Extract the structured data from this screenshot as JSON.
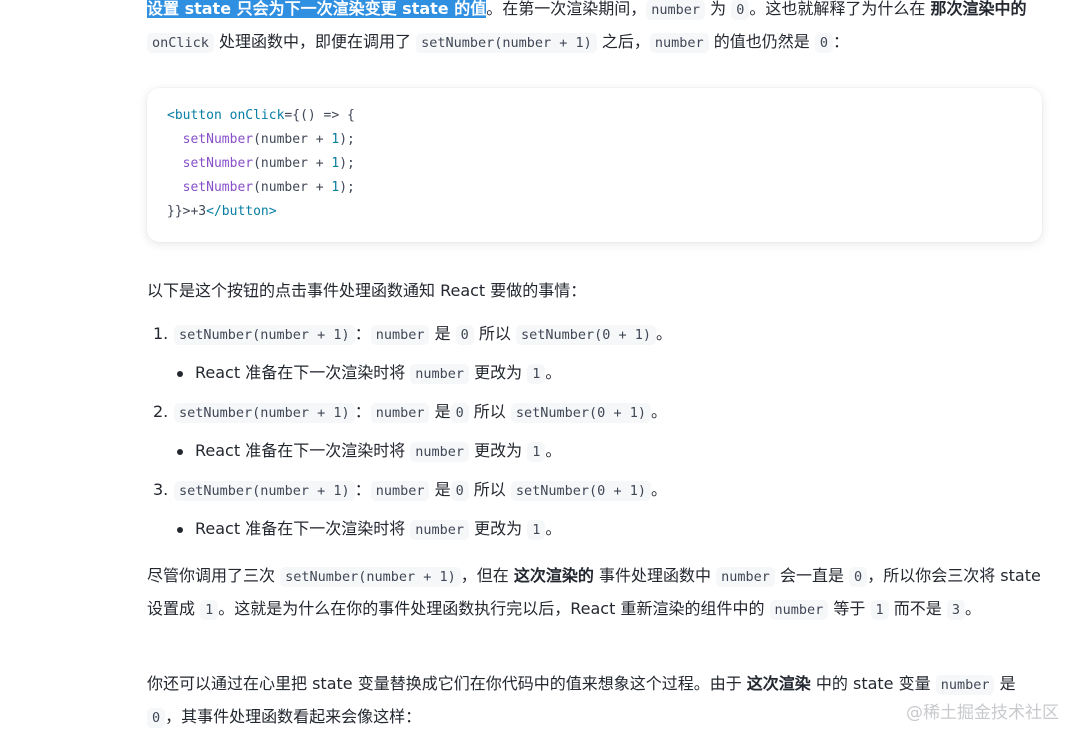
{
  "p1": {
    "highlight": "设置 state 只会为下一次渲染变更 state 的值",
    "t1": "。在第一次渲染期间，",
    "c1": "number",
    "t2": " 为 ",
    "c2": "0",
    "t3": "。这也就解释了为什么在 ",
    "b1": "那次渲染中的",
    "t4": " ",
    "c3": "onClick",
    "t5": " 处理函数中，即便在调用了 ",
    "c4": "setNumber(number + 1)",
    "t6": " 之后，",
    "c5": "number",
    "t7": " 的值也仍然是 ",
    "c6": "0",
    "t8": "："
  },
  "code": {
    "l1_tag_open": "<button",
    "l1_attr": "onClick",
    "l1_rest": "={() => {",
    "fn": "setNumber",
    "call_args": "(number + ",
    "one": "1",
    "call_end": ");",
    "l5_a": "}}>",
    "l5_b": "+3",
    "l5_c": "</button>"
  },
  "p2": "以下是这个按钮的点击事件处理函数通知 React 要做的事情：",
  "steps": [
    {
      "num": "1.",
      "code": "setNumber(number + 1)",
      "colon": "：",
      "c2": "number",
      "t1": " 是 ",
      "c3": "0",
      "t2": " 所以 ",
      "c4": "setNumber(0 + 1)",
      "end": "。",
      "sub": {
        "t1": "React 准备在下一次渲染时将 ",
        "c1": "number",
        "t2": " 更改为 ",
        "c2": "1",
        "end": "。"
      }
    },
    {
      "num": "2.",
      "code": "setNumber(number + 1)",
      "colon": "：",
      "c2": "number",
      "t1": " 是",
      "c3": "0",
      "t2": " 所以 ",
      "c4": "setNumber(0 + 1)",
      "end": "。",
      "sub": {
        "t1": "React 准备在下一次渲染时将 ",
        "c1": "number",
        "t2": " 更改为 ",
        "c2": "1",
        "end": "。"
      }
    },
    {
      "num": "3.",
      "code": "setNumber(number + 1)",
      "colon": "：",
      "c2": "number",
      "t1": " 是",
      "c3": "0",
      "t2": " 所以 ",
      "c4": "setNumber(0 + 1)",
      "end": "。",
      "sub": {
        "t1": "React 准备在下一次渲染时将 ",
        "c1": "number",
        "t2": " 更改为 ",
        "c2": "1",
        "end": "。"
      }
    }
  ],
  "p3": {
    "t1": "尽管你调用了三次 ",
    "c1": "setNumber(number + 1)",
    "t2": "，但在 ",
    "b1": "这次渲染的",
    "t3": " 事件处理函数中 ",
    "c2": "number",
    "t4": " 会一直是 ",
    "c3": "0",
    "t5": "，所以你会三次将 state 设置成 ",
    "c4": "1",
    "t6": "。这就是为什么在你的事件处理函数执行完以后，React 重新渲染的组件中的 ",
    "c5": "number",
    "t7": " 等于 ",
    "c6": "1",
    "t8": " 而不是 ",
    "c7": "3",
    "t9": "。"
  },
  "p4": {
    "t1": "你还可以通过在心里把 state 变量替换成它们在你代码中的值来想象这个过程。由于 ",
    "b1": "这次渲染",
    "t2": " 中的 state 变量 ",
    "c1": "number",
    "t3": " 是 ",
    "c2": "0",
    "t4": "，其事件处理函数看起来会像这样："
  },
  "watermark": "@稀土掘金技术社区"
}
